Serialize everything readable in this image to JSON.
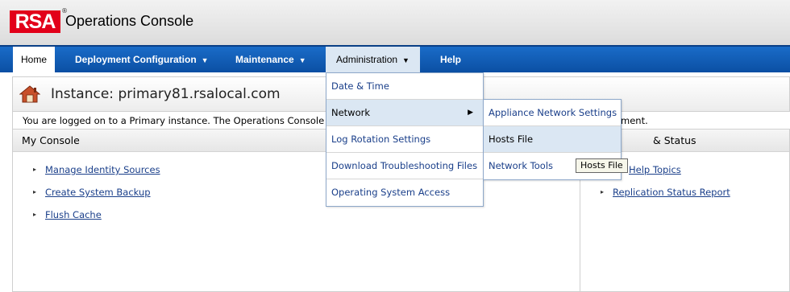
{
  "header": {
    "logo_text": "RSA",
    "logo_mark": "®",
    "app_title": "Operations Console",
    "brand_color": "#e2001a"
  },
  "nav": {
    "items": [
      {
        "label": "Home"
      },
      {
        "label": "Deployment Configuration",
        "caret": "▼"
      },
      {
        "label": "Maintenance",
        "caret": "▼"
      },
      {
        "label": "Administration",
        "caret": "▼"
      },
      {
        "label": "Help"
      }
    ],
    "accent": "#0b4fa3"
  },
  "instance": {
    "icon": "house-icon",
    "title": "Instance: primary81.rsalocal.com",
    "message": "You are logged on to a Primary instance. The Operations Console",
    "message_tail": "ment."
  },
  "my_console": {
    "title": "My Console",
    "links": [
      {
        "label": "Manage Identity Sources"
      },
      {
        "label": "Create System Backup"
      },
      {
        "label": "Flush Cache"
      }
    ]
  },
  "status_panel": {
    "title": "& Status",
    "links": [
      {
        "label": "Help Topics"
      },
      {
        "label": "Replication Status Report"
      }
    ]
  },
  "admin_menu": {
    "items": [
      {
        "label": "Date & Time"
      },
      {
        "label": "Network",
        "arrow": "▶"
      },
      {
        "label": "Log Rotation Settings"
      },
      {
        "label": "Download Troubleshooting Files"
      },
      {
        "label": "Operating System Access"
      }
    ]
  },
  "network_submenu": {
    "items": [
      {
        "label": "Appliance Network Settings"
      },
      {
        "label": "Hosts File"
      },
      {
        "label": "Network Tools"
      }
    ]
  },
  "tooltip": {
    "text": "Hosts File"
  }
}
